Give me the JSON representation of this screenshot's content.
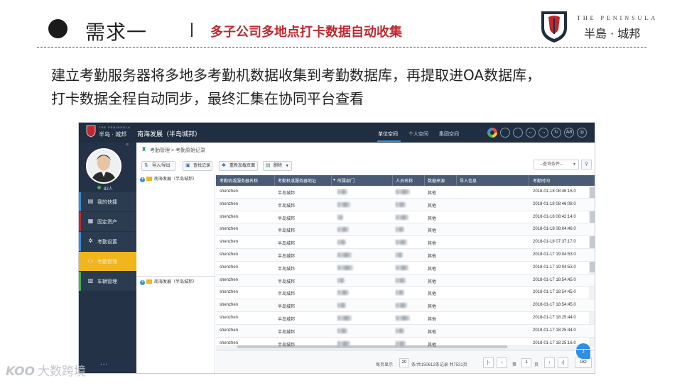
{
  "slide": {
    "title": "需求一",
    "subtitle": "多子公司多地点打卡数据自动收集",
    "body_line1": "建立考勤服务器将多地多考勤机数据收集到考勤数据库，再提取进OA数据库，",
    "body_line2": "打卡数据全程自动同步，最终汇集在协同平台查看"
  },
  "logo": {
    "en": "THE PENINSULA",
    "cn": "半島 · 城邦"
  },
  "app": {
    "brand_en": "THE PENINSULA",
    "brand_cn": "半岛 · 城邦",
    "company": "南海发展（半岛城邦）",
    "tabs": [
      "单位空间",
      "个人空间",
      "集团空间"
    ],
    "active_tab": "单位空间",
    "top_icons": [
      "color-wheel-icon",
      "circle-icon",
      "circle-icon",
      "back-icon",
      "forward-icon",
      "refresh-icon",
      "font-size-icon",
      "settings-icon"
    ],
    "font_icon_label": "A8",
    "user_count": "82人",
    "sidebar": [
      {
        "label": "我的快捷",
        "icon": "shortcut-icon",
        "accent": "#2f8fe0"
      },
      {
        "label": "固定资产",
        "icon": "asset-icon",
        "accent": "#c0282e"
      },
      {
        "label": "考勤设置",
        "icon": "gear-icon",
        "accent": "#2f8fe0"
      },
      {
        "label": "考勤管理",
        "icon": "attendance-icon",
        "accent": "#f2b51a"
      },
      {
        "label": "车辆管理",
        "icon": "car-icon",
        "accent": "#3fb34f"
      }
    ],
    "active_sidebar": "考勤管理",
    "more": "...",
    "breadcrumb": "考勤管理 > 考勤原始记录",
    "toolbar": [
      {
        "label": "导入/导出",
        "icon": "import-export-icon"
      },
      {
        "label": "查找记录",
        "icon": "search-record-icon"
      },
      {
        "label": "重新加载页面",
        "icon": "reload-icon"
      },
      {
        "label": "删除",
        "icon": "delete-icon"
      }
    ],
    "query_placeholder": "--查询条件--",
    "tree": [
      "南海发展（半岛城邦）",
      "南海发展（半岛城邦）"
    ],
    "columns": [
      "考勤机或服务器名称",
      "考勤机或服务器地址",
      "所属部门",
      "人员名称",
      "数据来源",
      "导入信息",
      "考勤时间"
    ],
    "rows": [
      {
        "server": "shenzhen",
        "address": "半岛城邦",
        "source": "其他",
        "time": "2018-01-18 08:46:16.0"
      },
      {
        "server": "shenzhen",
        "address": "半岛城邦",
        "source": "其他",
        "time": "2018-01-18 08:46:08.0"
      },
      {
        "server": "shenzhen",
        "address": "半岛城邦",
        "source": "其他",
        "time": "2018-01-18 08:42:14.0"
      },
      {
        "server": "shenzhen",
        "address": "半岛城邦",
        "source": "其他",
        "time": "2018-01-18 08:04:46.0"
      },
      {
        "server": "shenzhen",
        "address": "半岛城邦",
        "source": "其他",
        "time": "2018-01-18 07:37:17.0"
      },
      {
        "server": "shenzhen",
        "address": "半岛城邦",
        "source": "其他",
        "time": "2018-01-17 19:04:53.0"
      },
      {
        "server": "shenzhen",
        "address": "半岛城邦",
        "source": "其他",
        "time": "2018-01-17 19:04:53.0"
      },
      {
        "server": "shenzhen",
        "address": "半岛城邦",
        "source": "其他",
        "time": "2018-01-17 18:54:45.0"
      },
      {
        "server": "shenzhen",
        "address": "半岛城邦",
        "source": "其他",
        "time": "2018-01-17 18:54:45.0"
      },
      {
        "server": "shenzhen",
        "address": "半岛城邦",
        "source": "其他",
        "time": "2018-01-17 18:54:45.0"
      },
      {
        "server": "shenzhen",
        "address": "半岛城邦",
        "source": "其他",
        "time": "2018-01-17 18:25:44.0"
      },
      {
        "server": "shenzhen",
        "address": "半岛城邦",
        "source": "其他",
        "time": "2018-01-17 18:25:44.0"
      },
      {
        "server": "shenzhen",
        "address": "半岛城邦",
        "source": "其他",
        "time": "2018-01-17 18:25:16.0"
      }
    ],
    "pager": {
      "per_page_prefix": "每页显示",
      "per_page": "20",
      "summary": "条/共150612条记录  共7531页",
      "page_prefix": "第",
      "page": "1",
      "page_suffix": "页",
      "go": "GO"
    }
  },
  "watermark": {
    "logo": "KOO",
    "text": "大数跨境"
  },
  "colors": {
    "accent_red": "#c0282e",
    "nav_dark": "#1f2e40",
    "active_yellow": "#f2b51a",
    "header_slate": "#4a5c75"
  }
}
